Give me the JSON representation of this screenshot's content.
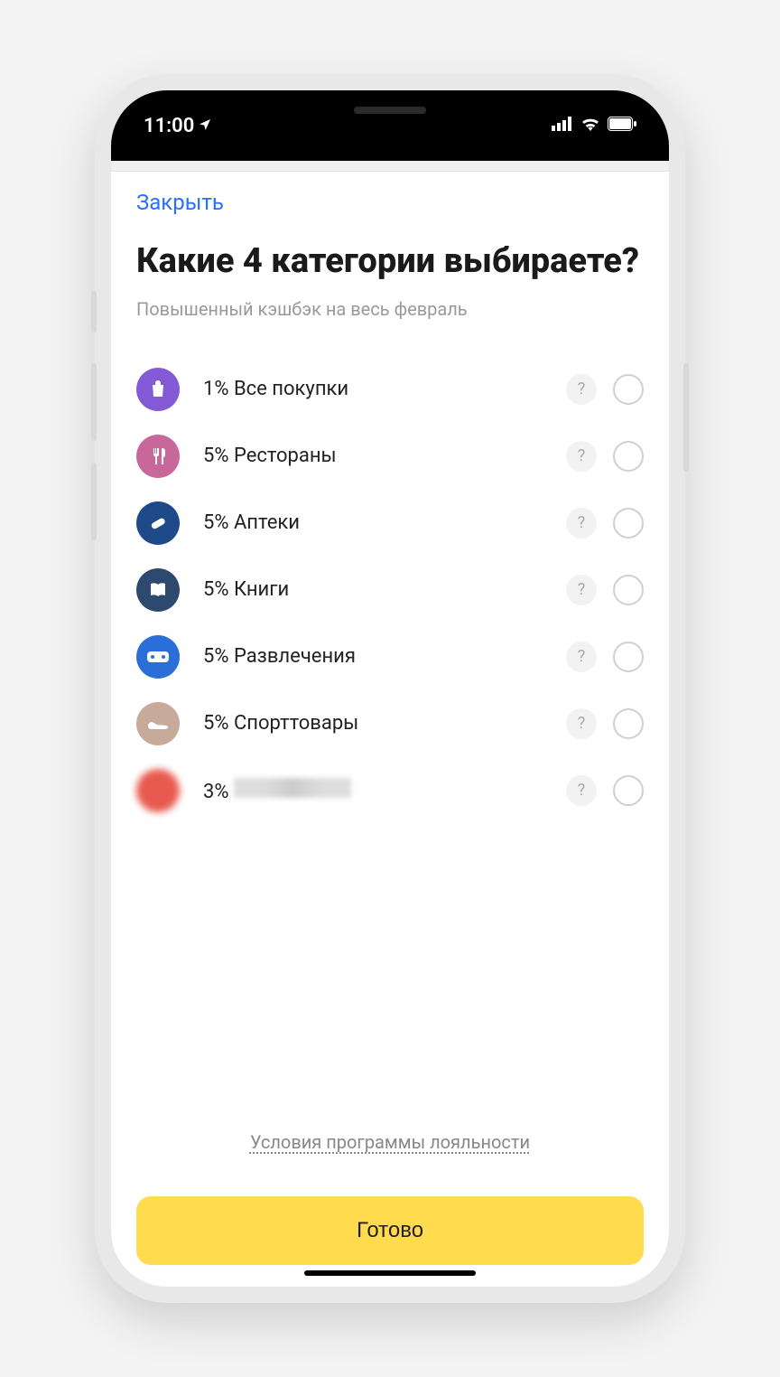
{
  "status": {
    "time": "11:00",
    "location_icon": "location-arrow-icon",
    "signal_icon": "cellular-signal-icon",
    "wifi_icon": "wifi-icon",
    "battery_icon": "battery-full-icon"
  },
  "nav": {
    "close_label": "Закрыть"
  },
  "title": "Какие 4 категории выбираете?",
  "subtitle": "Повышенный кэшбэк на весь февраль",
  "categories": [
    {
      "icon": "shopping-bag-icon",
      "color": "#8459d6",
      "percent": "1%",
      "name": "Все покупки"
    },
    {
      "icon": "cutlery-icon",
      "color": "#c8689a",
      "percent": "5%",
      "name": "Рестораны"
    },
    {
      "icon": "pill-icon",
      "color": "#1f4a8a",
      "percent": "5%",
      "name": "Аптеки"
    },
    {
      "icon": "book-icon",
      "color": "#2d4a6e",
      "percent": "5%",
      "name": "Книги"
    },
    {
      "icon": "gamepad-icon",
      "color": "#2a6fd8",
      "percent": "5%",
      "name": "Развлечения"
    },
    {
      "icon": "sneaker-icon",
      "color": "#c7aa9a",
      "percent": "5%",
      "name": "Спорттовары"
    },
    {
      "icon": "redacted-icon",
      "color": "#e85a4f",
      "percent": "3%",
      "name": null,
      "redacted": true
    }
  ],
  "terms_link": "Условия программы лояльности",
  "done_button": "Готово",
  "help_glyph": "?"
}
